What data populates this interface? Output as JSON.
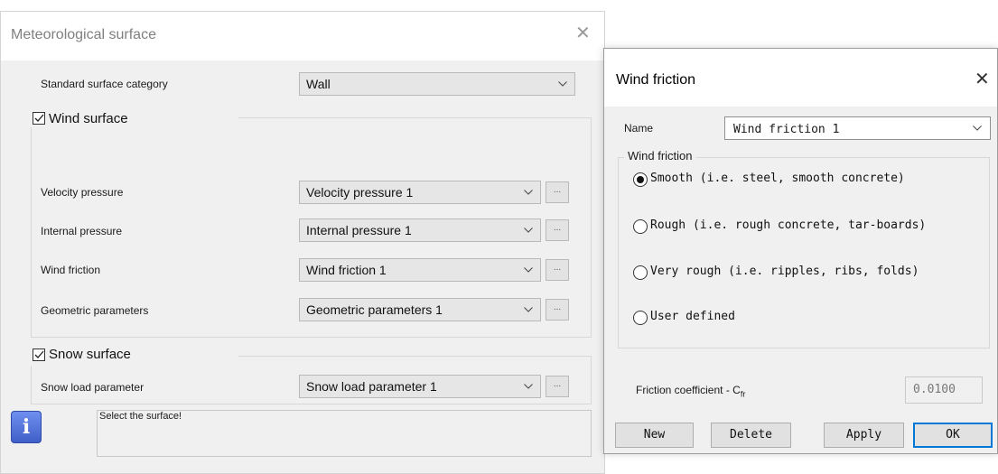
{
  "main": {
    "title": "Meteorological surface",
    "standard_label": "Standard surface category",
    "standard_value": "Wall",
    "wind_surface": {
      "label": "Wind surface",
      "checked": true,
      "rows": [
        {
          "label": "Velocity pressure",
          "value": "Velocity pressure 1"
        },
        {
          "label": "Internal pressure",
          "value": "Internal pressure 1"
        },
        {
          "label": "Wind friction",
          "value": "Wind friction 1"
        },
        {
          "label": "Geometric parameters",
          "value": "Geometric parameters 1"
        }
      ]
    },
    "snow_surface": {
      "label": "Snow surface",
      "checked": true,
      "rows": [
        {
          "label": "Snow load parameter",
          "value": "Snow load parameter 1"
        }
      ]
    },
    "dots_label": "...",
    "info_message": "Select the surface!",
    "info_icon": "info-icon"
  },
  "wind_friction": {
    "title": "Wind friction",
    "name_label": "Name",
    "name_value": "Wind friction 1",
    "group_label": "Wind friction",
    "options": [
      {
        "label": "Smooth (i.e. steel, smooth concrete)",
        "selected": true
      },
      {
        "label": "Rough (i.e. rough concrete, tar-boards)",
        "selected": false
      },
      {
        "label": "Very rough (i.e. ripples, ribs, folds)",
        "selected": false
      },
      {
        "label": "User defined",
        "selected": false
      }
    ],
    "coef_label": "Friction coefficient - C",
    "coef_sub": "fr",
    "coef_value": "0.0100",
    "buttons": {
      "new": "New",
      "delete": "Delete",
      "apply": "Apply",
      "ok": "OK"
    }
  },
  "colors": {
    "accent": "#0078d7",
    "info_icon": "#4a6fd4"
  }
}
